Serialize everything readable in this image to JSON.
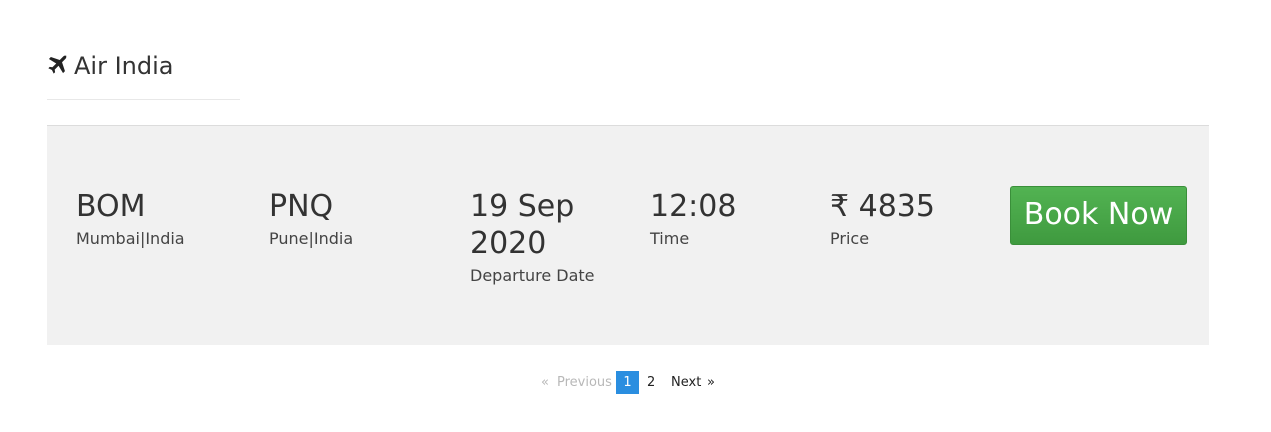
{
  "airline": {
    "icon": "plane-icon",
    "name": "Air India"
  },
  "flight": {
    "origin": {
      "code": "BOM",
      "place": "Mumbai|India"
    },
    "destination": {
      "code": "PNQ",
      "place": "Pune|India"
    },
    "departure": {
      "date": "19 Sep 2020",
      "label": "Departure Date"
    },
    "time": {
      "value": "12:08",
      "label": "Time"
    },
    "price": {
      "value": "₹ 4835",
      "label": "Price"
    },
    "book_label": "Book Now",
    "book_color": "#4aa84a"
  },
  "pagination": {
    "prev_arrow": "«",
    "prev_label": "Previous",
    "pages": [
      "1",
      "2"
    ],
    "current": "1",
    "next_label": "Next",
    "next_arrow": "»",
    "active_color": "#2a8ee0"
  }
}
